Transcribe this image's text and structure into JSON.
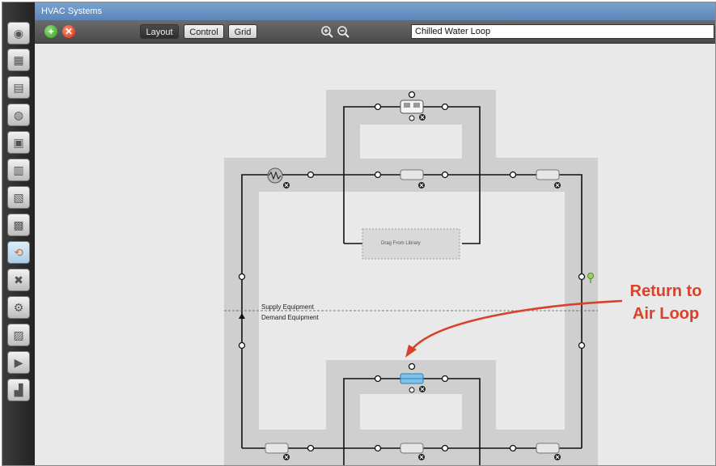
{
  "window": {
    "title": "HVAC Systems"
  },
  "toolbar": {
    "add_symbol": "+",
    "remove_symbol": "✕",
    "tabs": [
      "Layout",
      "Control",
      "Grid"
    ],
    "zoom_in_icon": "zoom-in-icon",
    "zoom_out_icon": "zoom-out-icon",
    "loop_selected": "Chilled Water Loop"
  },
  "sidebar": {
    "items": [
      {
        "icon": "site-icon"
      },
      {
        "icon": "schedules-icon"
      },
      {
        "icon": "constructions-icon"
      },
      {
        "icon": "loads-icon"
      },
      {
        "icon": "space-types-icon"
      },
      {
        "icon": "geometry-icon"
      },
      {
        "icon": "facility-icon"
      },
      {
        "icon": "spaces-icon"
      },
      {
        "icon": "thermal-zones-icon"
      },
      {
        "icon": "hvac-systems-icon",
        "active": true
      },
      {
        "icon": "building-summary-icon"
      },
      {
        "icon": "output-variables-icon"
      },
      {
        "icon": "simulation-settings-icon"
      },
      {
        "icon": "run-simulation-icon"
      },
      {
        "icon": "results-summary-icon"
      }
    ]
  },
  "canvas": {
    "drop_zone_label": "Drag From Library",
    "supply_label": "Supply Equipment",
    "demand_label": "Demand Equipment",
    "callout_line1": "Return to",
    "callout_line2": "Air Loop",
    "remove_glyph": "✕"
  },
  "colors": {
    "accent": "#d8412a",
    "selected_component": "#7ec3ea",
    "titlebar": "#6a93c4"
  }
}
